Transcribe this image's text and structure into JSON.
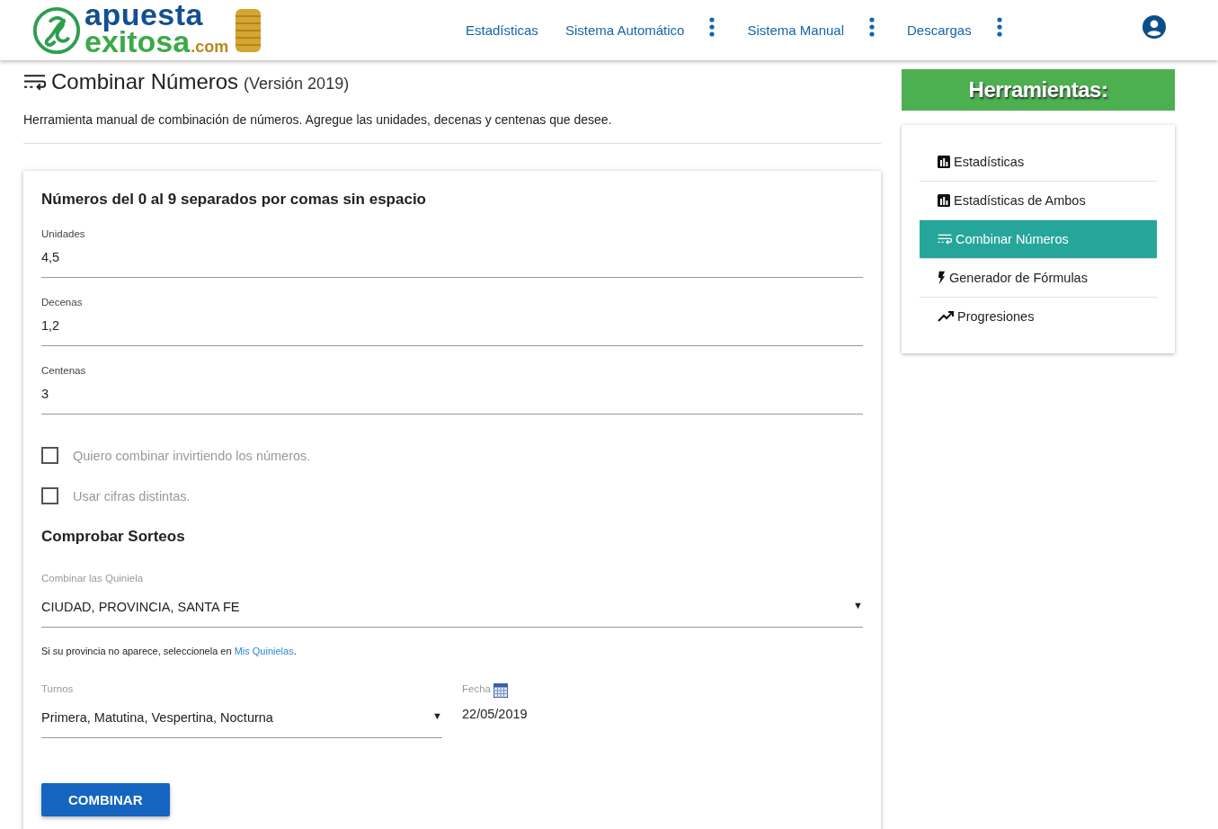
{
  "logo": {
    "line_1": "apuesta",
    "line_2": "exitosa",
    "suffix": ".com"
  },
  "nav": [
    {
      "label": "Estadísticas",
      "menu": false
    },
    {
      "label": "Sistema Automático",
      "menu": true
    },
    {
      "label": "Sistema Manual",
      "menu": true
    },
    {
      "label": "Descargas",
      "menu": true
    }
  ],
  "page": {
    "title": "Combinar Números",
    "version": "(Versión 2019)",
    "description": "Herramienta manual de combinación de números. Agregue las unidades, decenas y centenas que desee."
  },
  "form": {
    "heading": "Números del 0 al 9 separados por comas sin espacio",
    "fields": [
      {
        "label": "Unidades",
        "value": "4,5"
      },
      {
        "label": "Decenas",
        "value": "1,2"
      },
      {
        "label": "Centenas",
        "value": "3"
      }
    ],
    "checkboxes": [
      {
        "label": "Quiero combinar invirtiendo los números.",
        "checked": false
      },
      {
        "label": "Usar cifras distintas.",
        "checked": false
      }
    ],
    "section": "Comprobar Sorteos",
    "quiniela": {
      "label": "Combinar las Quiniela",
      "value": "CIUDAD, PROVINCIA, SANTA FE",
      "arrow": "▼"
    },
    "hint": {
      "text": "Si su provincia no aparece, seleccionela en ",
      "link": "Mis Quinielas",
      "end": "."
    },
    "turnos": {
      "label": "Turnos",
      "value": "Primera, Matutina, Vespertina, Nocturna",
      "arrow": "▼"
    },
    "fecha": {
      "label": "Fecha",
      "value": "22/05/2019"
    },
    "button": "COMBINAR"
  },
  "sidebar": {
    "title": "Herramientas:",
    "items": [
      {
        "label": "Estadísticas",
        "kind": "chart",
        "selected": false
      },
      {
        "label": "Estadísticas de Ambos",
        "kind": "chart",
        "selected": false
      },
      {
        "label": "Combinar Números",
        "kind": "wrap",
        "selected": true
      },
      {
        "label": "Generador de Fórmulas",
        "kind": "bolt",
        "selected": false
      },
      {
        "label": "Progresiones",
        "kind": "trend",
        "selected": false
      }
    ]
  }
}
